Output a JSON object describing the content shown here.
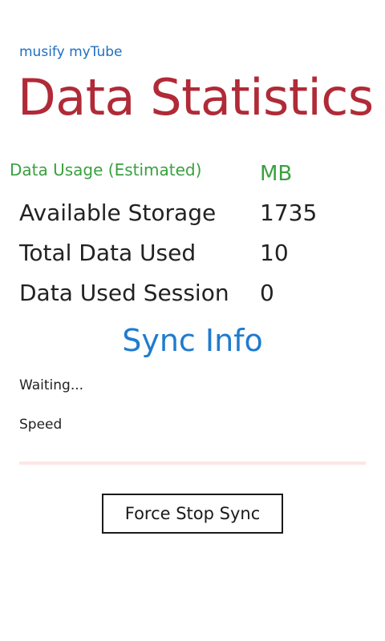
{
  "app": {
    "title": "musify myTube",
    "page_title": "Data Statistics"
  },
  "usage": {
    "header": "Data Usage (Estimated)",
    "unit": "MB",
    "rows": [
      {
        "label": "Available Storage",
        "value": "1735"
      },
      {
        "label": "Total Data Used",
        "value": "10"
      },
      {
        "label": "Data Used Session",
        "value": "0"
      }
    ]
  },
  "sync": {
    "title": "Sync Info",
    "status": "Waiting...",
    "speed_label": "Speed",
    "progress": 0,
    "button_label": "Force Stop Sync"
  },
  "colors": {
    "app_title": "#1f6fbf",
    "page_title": "#b02a37",
    "usage_header": "#3aa040",
    "sync_title": "#1f7bcf",
    "progress_track": "#fde6e6"
  }
}
